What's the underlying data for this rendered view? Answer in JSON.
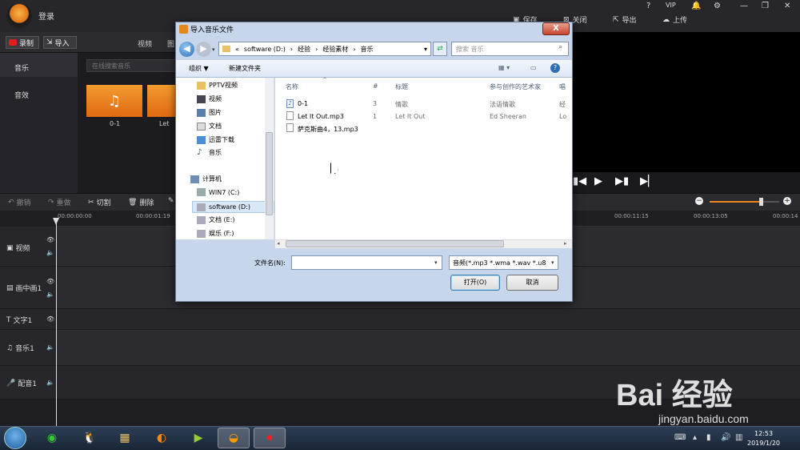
{
  "app": {
    "login": "登录",
    "top_buttons": {
      "save": "保存",
      "close": "关闭",
      "export": "导出",
      "upload": "上传"
    },
    "window_controls": [
      "?",
      "VIP",
      "bell",
      "gear",
      "minimize",
      "restore",
      "close"
    ]
  },
  "toolbar": {
    "record": "录制",
    "import": "导入",
    "tabs": [
      "视频",
      "图"
    ]
  },
  "left_nav": {
    "items": [
      "音乐",
      "音效"
    ]
  },
  "media": {
    "search_placeholder": "在线搜索音乐",
    "thumbs": [
      {
        "label": "0-1"
      },
      {
        "label": "Let"
      }
    ]
  },
  "timeline": {
    "tools": {
      "undo": "撤销",
      "redo": "重做",
      "cut": "切割",
      "delete": "删除"
    },
    "ticks": [
      "00:00:00:00",
      "00:00:01:19",
      "00:00:11:15",
      "00:00:13:05",
      "00:00:14"
    ],
    "tracks": [
      "视频",
      "画中画1",
      "文字1",
      "音乐1",
      "配音1"
    ],
    "zoom_level": 0.73
  },
  "dialog": {
    "title": "导入音乐文件",
    "close": "X",
    "breadcrumb": [
      "software (D:)",
      "经验",
      "经验素材",
      "音乐"
    ],
    "search_placeholder": "搜索 音乐",
    "commands": {
      "organize": "组织 ▼",
      "new_folder": "新建文件夹"
    },
    "nav_items": [
      {
        "label": "PPTV视频",
        "icon": "video-folder-icon"
      },
      {
        "label": "视频",
        "icon": "video-icon"
      },
      {
        "label": "图片",
        "icon": "picture-icon"
      },
      {
        "label": "文档",
        "icon": "document-icon"
      },
      {
        "label": "迅雷下载",
        "icon": "download-icon"
      },
      {
        "label": "音乐",
        "icon": "music-icon"
      },
      {
        "label": "计算机",
        "icon": "computer-icon"
      },
      {
        "label": "WIN7 (C:)",
        "icon": "system-drive-icon"
      },
      {
        "label": "software (D:)",
        "icon": "drive-icon"
      },
      {
        "label": "文档 (E:)",
        "icon": "drive-icon"
      },
      {
        "label": "娱乐 (F:)",
        "icon": "drive-icon"
      }
    ],
    "columns": [
      "名称",
      "#",
      "标题",
      "参与创作的艺术家",
      "唱"
    ],
    "files": [
      {
        "name": "0-1",
        "num": "3",
        "title": "情歌",
        "artist": "法语情歌",
        "album": "经"
      },
      {
        "name": "Let It Out.mp3",
        "num": "1",
        "title": "Let It Out",
        "artist": "Ed Sheeran",
        "album": "Lo"
      },
      {
        "name": "萨克斯曲4，13.mp3",
        "num": "",
        "title": "",
        "artist": "",
        "album": ""
      }
    ],
    "filename_label": "文件名(N):",
    "filename_value": "",
    "filetype": "音频(*.mp3 *.wma *.wav *.u8",
    "open_button": "打开(O)",
    "cancel_button": "取消"
  },
  "taskbar": {
    "time": "12:53",
    "date": "2019/1/20"
  },
  "watermark": {
    "line1": "Bai 经验",
    "line2": "jingyan.baidu.com"
  }
}
